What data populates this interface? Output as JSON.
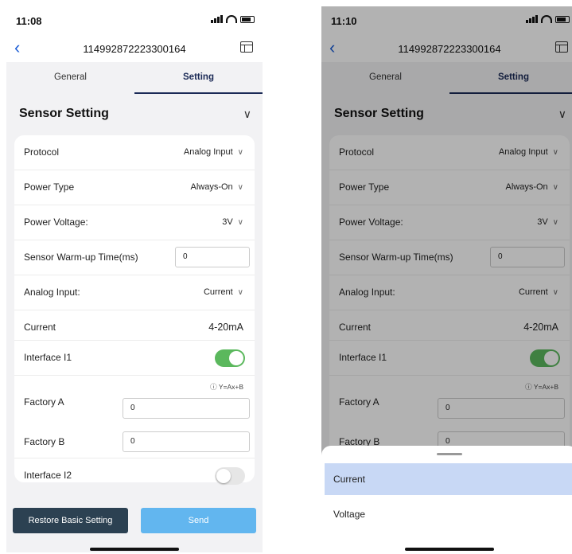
{
  "screens": [
    {
      "status": {
        "time": "11:08"
      },
      "nav": {
        "title": "114992872223300164"
      },
      "tabs": [
        {
          "label": "General"
        },
        {
          "label": "Setting"
        }
      ],
      "section": {
        "title": "Sensor Setting"
      },
      "rows": {
        "protocol": {
          "label": "Protocol",
          "value": "Analog Input"
        },
        "power_type": {
          "label": "Power Type",
          "value": "Always-On"
        },
        "power_voltage": {
          "label": "Power Voltage:",
          "value": "3V"
        },
        "warmup": {
          "label": "Sensor Warm-up Time(ms)",
          "value": "0"
        },
        "analog_input": {
          "label": "Analog Input:",
          "value": "Current"
        },
        "current": {
          "label": "Current",
          "value": "4-20mA"
        },
        "interface_i1": {
          "label": "Interface I1",
          "enabled": true
        },
        "factory_a": {
          "label": "Factory A",
          "value": "0",
          "hint": "Y=Ax+B"
        },
        "factory_b": {
          "label": "Factory B",
          "value": "0"
        },
        "interface_i2": {
          "label": "Interface I2",
          "enabled": false
        }
      },
      "buttons": {
        "restore": "Restore Basic Setting",
        "send": "Send"
      }
    },
    {
      "status": {
        "time": "11:10"
      },
      "nav": {
        "title": "114992872223300164"
      },
      "tabs": [
        {
          "label": "General"
        },
        {
          "label": "Setting"
        }
      ],
      "section": {
        "title": "Sensor Setting"
      },
      "rows": {
        "protocol": {
          "label": "Protocol",
          "value": "Analog Input"
        },
        "power_type": {
          "label": "Power Type",
          "value": "Always-On"
        },
        "power_voltage": {
          "label": "Power Voltage:",
          "value": "3V"
        },
        "warmup": {
          "label": "Sensor Warm-up Time(ms)",
          "value": "0"
        },
        "analog_input": {
          "label": "Analog Input:",
          "value": "Current"
        },
        "current": {
          "label": "Current",
          "value": "4-20mA"
        },
        "interface_i1": {
          "label": "Interface I1",
          "enabled": true
        },
        "factory_a": {
          "label": "Factory A",
          "value": "0",
          "hint": "Y=Ax+B"
        },
        "factory_b": {
          "label": "Factory B",
          "value": "0"
        }
      },
      "picker": {
        "options": [
          "Current",
          "Voltage"
        ],
        "selected": "Current"
      }
    }
  ],
  "colors": {
    "accent": "#1e5fd6",
    "tab_active": "#1b2a56",
    "toggle_on": "#5bb85d",
    "send": "#62b6ef",
    "restore": "#2c4152",
    "picker_selected": "#c8d8f5"
  },
  "icons": {
    "back": "chevron-left-icon",
    "table": "table-icon",
    "chevron": "chevron-down-icon",
    "help": "question-circle-icon"
  }
}
